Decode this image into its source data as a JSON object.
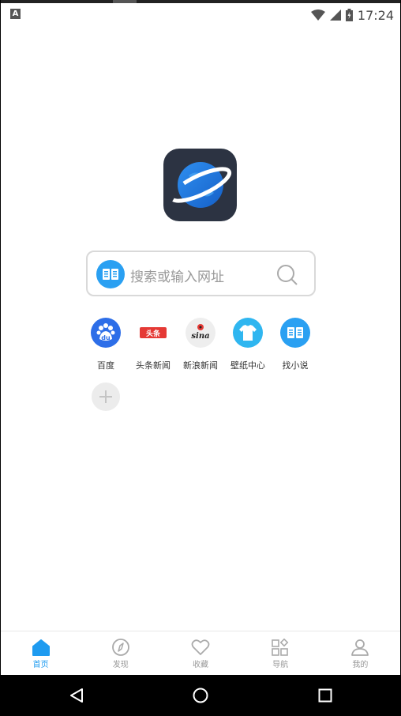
{
  "status_bar": {
    "time": "17:24",
    "notification_icon": "A"
  },
  "search": {
    "placeholder": "搜索或输入网址"
  },
  "shortcuts": [
    {
      "label": "百度",
      "icon": "baidu-icon",
      "color": "#2d6ee8"
    },
    {
      "label": "头条新闻",
      "icon": "toutiao-icon",
      "color": "#e53935"
    },
    {
      "label": "新浪新闻",
      "icon": "sina-icon",
      "color": "#eeeeee"
    },
    {
      "label": "壁纸中心",
      "icon": "tshirt-icon",
      "color": "#2fb6f0"
    },
    {
      "label": "找小说",
      "icon": "book-icon",
      "color": "#2aa0f2"
    }
  ],
  "shortcut_icon_text": {
    "baidu": "du",
    "toutiao": "头条",
    "sina": "sina"
  },
  "bottom_nav": [
    {
      "label": "首页",
      "icon": "home-icon",
      "active": true
    },
    {
      "label": "发现",
      "icon": "compass-icon",
      "active": false
    },
    {
      "label": "收藏",
      "icon": "heart-icon",
      "active": false
    },
    {
      "label": "导航",
      "icon": "grid-icon",
      "active": false
    },
    {
      "label": "我的",
      "icon": "user-icon",
      "active": false
    }
  ],
  "colors": {
    "accent": "#1e9bf0",
    "inactive": "#999999",
    "logo_bg": "#2c3342"
  }
}
